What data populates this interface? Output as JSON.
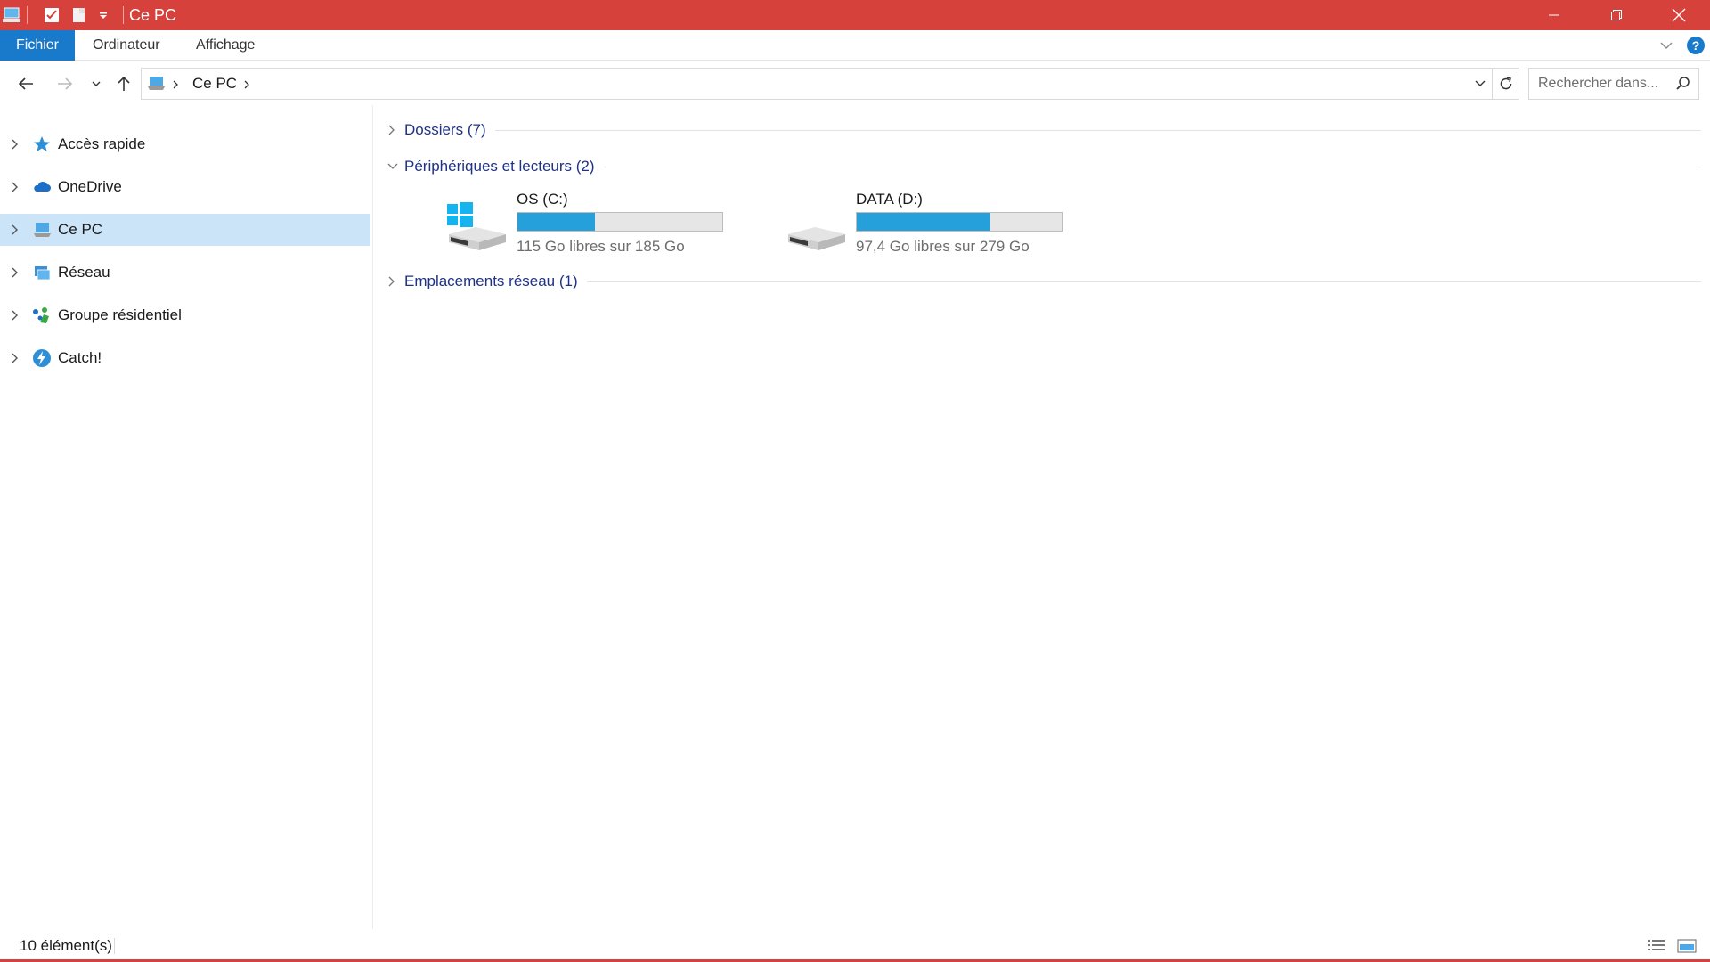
{
  "window": {
    "title": "Ce PC",
    "accent_color": "#d6423b",
    "controls": [
      "minimize-icon",
      "restore-icon",
      "close-icon"
    ]
  },
  "quick_access": [
    "explorer-app-icon",
    "properties-icon",
    "new-folder-icon",
    "customize-dropdown-icon"
  ],
  "ribbon": {
    "tabs": [
      {
        "label": "Fichier",
        "active": true
      },
      {
        "label": "Ordinateur"
      },
      {
        "label": "Affichage"
      }
    ],
    "help_label": "?"
  },
  "address_bar": {
    "location_icon": "this-pc-icon",
    "breadcrumbs": [
      "Ce PC"
    ],
    "search_placeholder": "Rechercher dans..."
  },
  "nav_pane": {
    "items": [
      {
        "label": "Accès rapide",
        "icon": "star-icon"
      },
      {
        "label": "OneDrive",
        "icon": "cloud-icon"
      },
      {
        "label": "Ce PC",
        "icon": "computer-icon",
        "selected": true
      },
      {
        "label": "Réseau",
        "icon": "network-icon"
      },
      {
        "label": "Groupe résidentiel",
        "icon": "homegroup-icon"
      },
      {
        "label": "Catch!",
        "icon": "catch-icon"
      }
    ]
  },
  "content": {
    "groups": [
      {
        "label": "Dossiers (7)",
        "expanded": false
      },
      {
        "label": "Périphériques et lecteurs (2)",
        "expanded": true
      },
      {
        "label": "Emplacements réseau (1)",
        "expanded": false
      }
    ],
    "drives": [
      {
        "name": "OS (C:)",
        "free_text": "115 Go libres sur 185 Go",
        "used_fraction": 0.378,
        "icon": "windows-drive-icon"
      },
      {
        "name": "DATA (D:)",
        "free_text": "97,4 Go libres sur 279 Go",
        "used_fraction": 0.651,
        "icon": "hard-drive-icon"
      }
    ]
  },
  "status_bar": {
    "item_count": "10 élément(s)",
    "view_buttons": [
      "details-view-icon",
      "large-icons-view-icon"
    ]
  }
}
